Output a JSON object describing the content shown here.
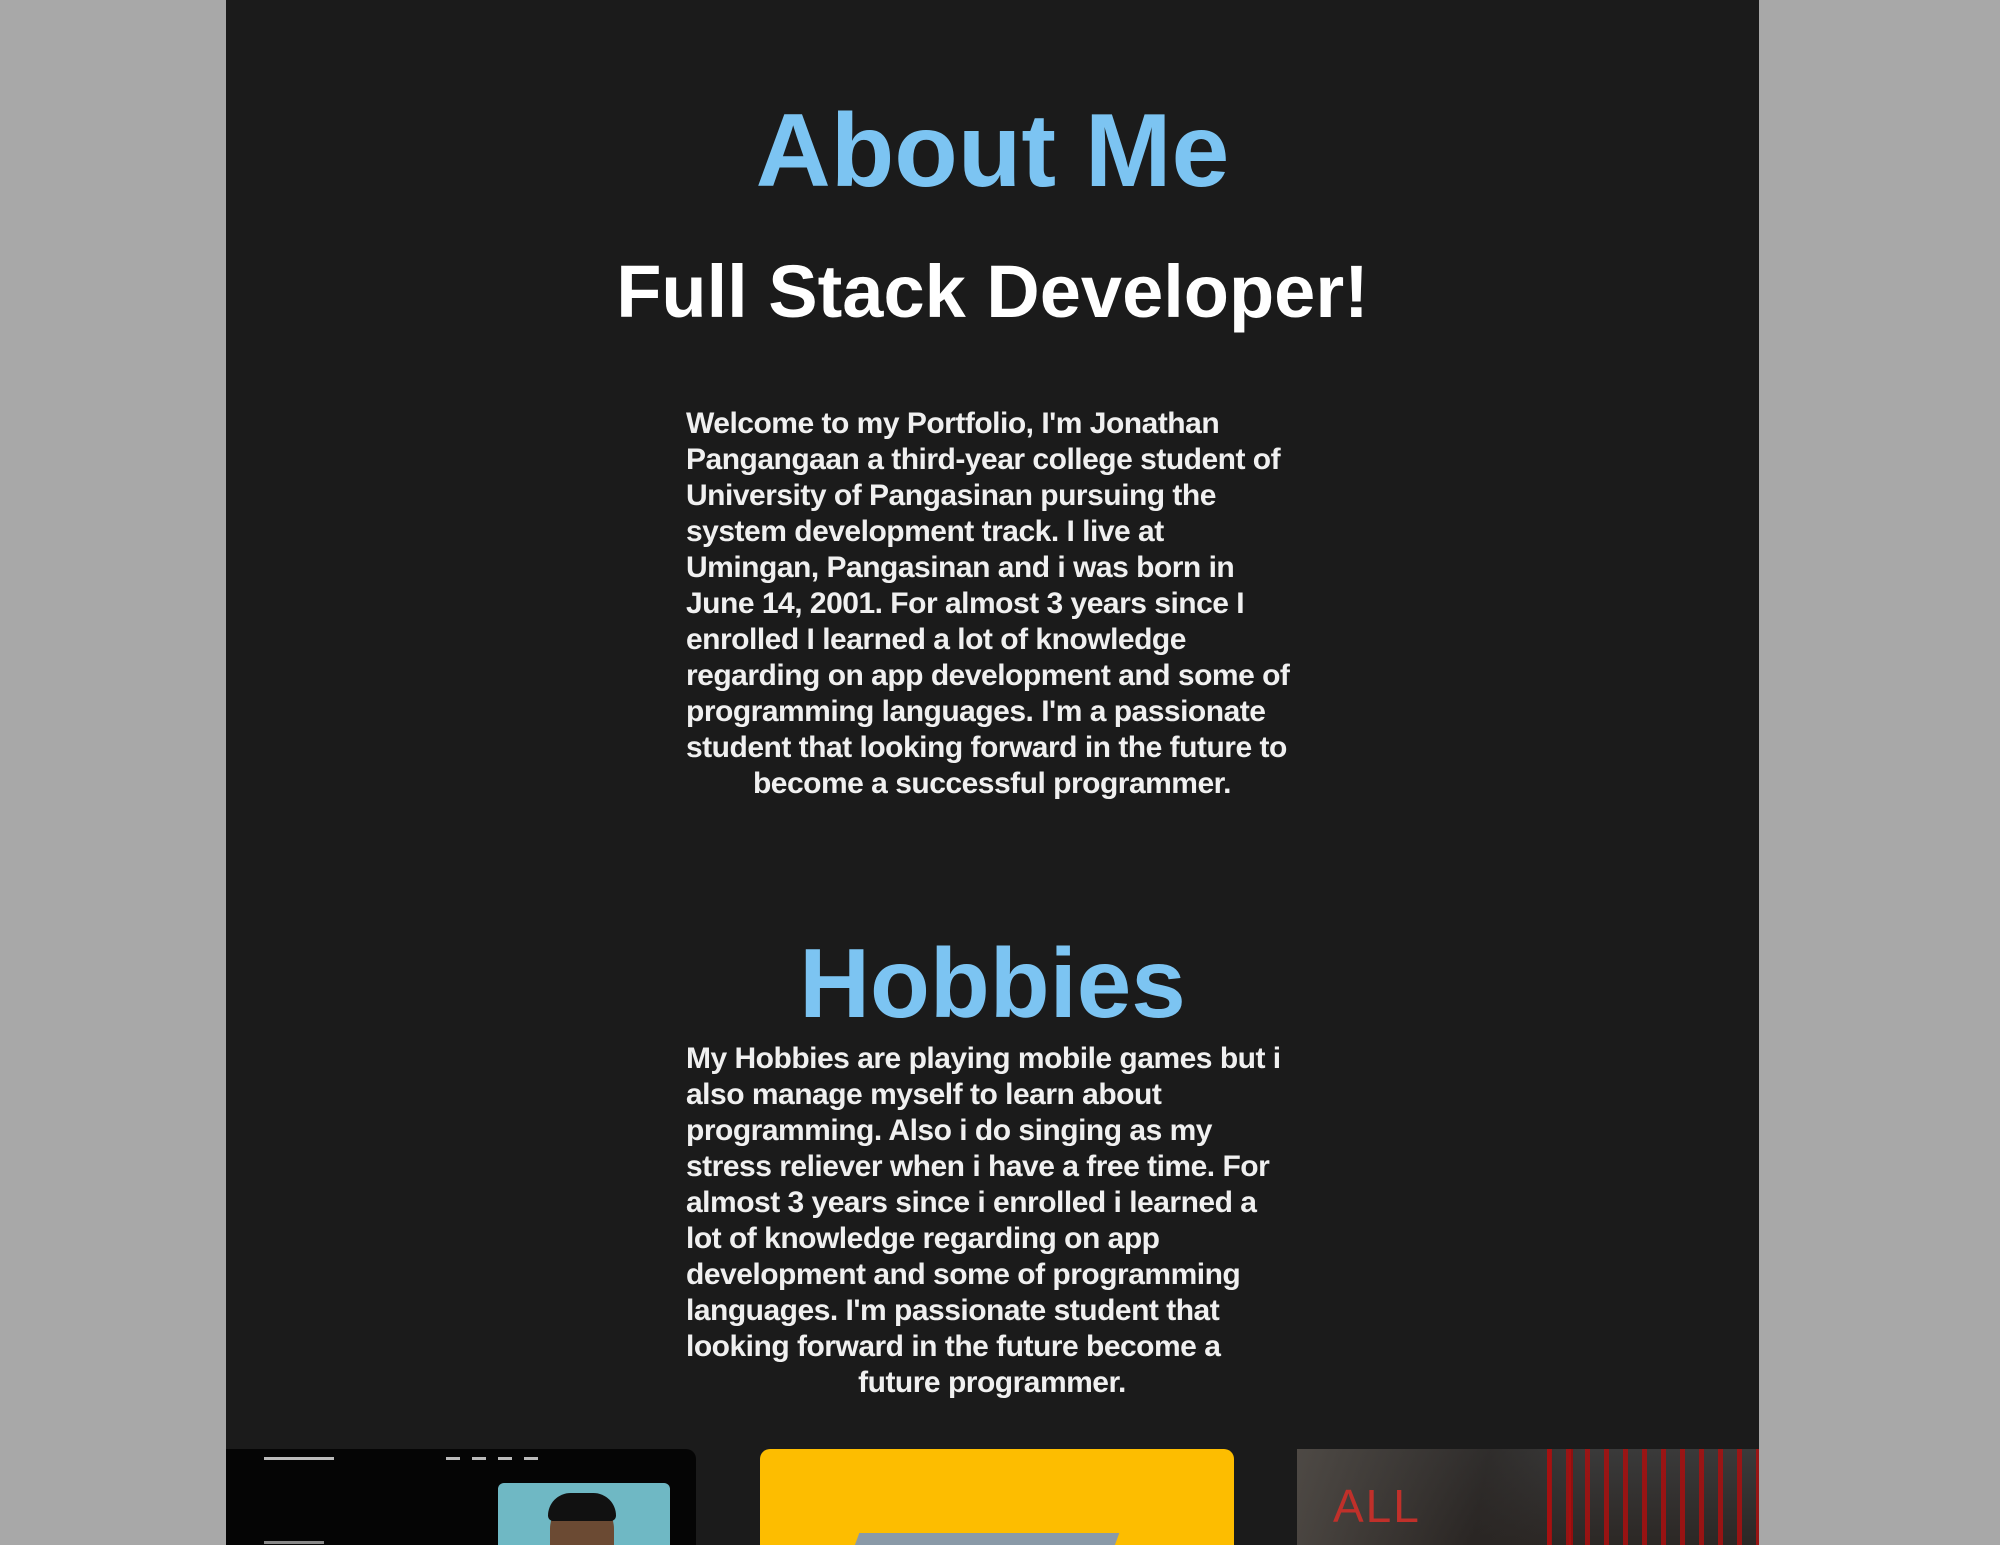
{
  "about": {
    "title": "About Me",
    "subtitle": "Full Stack Developer!",
    "text": "Welcome to my Portfolio, I'm Jonathan Pangangaan a third-year college student of University of Pangasinan pursuing the system development track. I live at Umingan, Pangasinan and i was born in June 14, 2001. For almost 3 years since I enrolled I learned a lot of knowledge regarding on app development and some of programming languages. I'm a passionate student that looking forward in the future to become a successful programmer."
  },
  "hobbies": {
    "title": "Hobbies",
    "text": "My Hobbies are playing mobile games but i also manage myself to learn about programming. Also i do singing as my stress reliever when i have a free time. For almost 3 years since i enrolled i learned a lot of knowledge regarding on app development and some of programming languages. I'm passionate student that looking forward in the future become a future programmer."
  },
  "gallery": {
    "third_label": "ALL"
  },
  "colors": {
    "accent": "#7cc4f2",
    "background": "#1b1b1b",
    "outer": "#a8a8a8"
  }
}
